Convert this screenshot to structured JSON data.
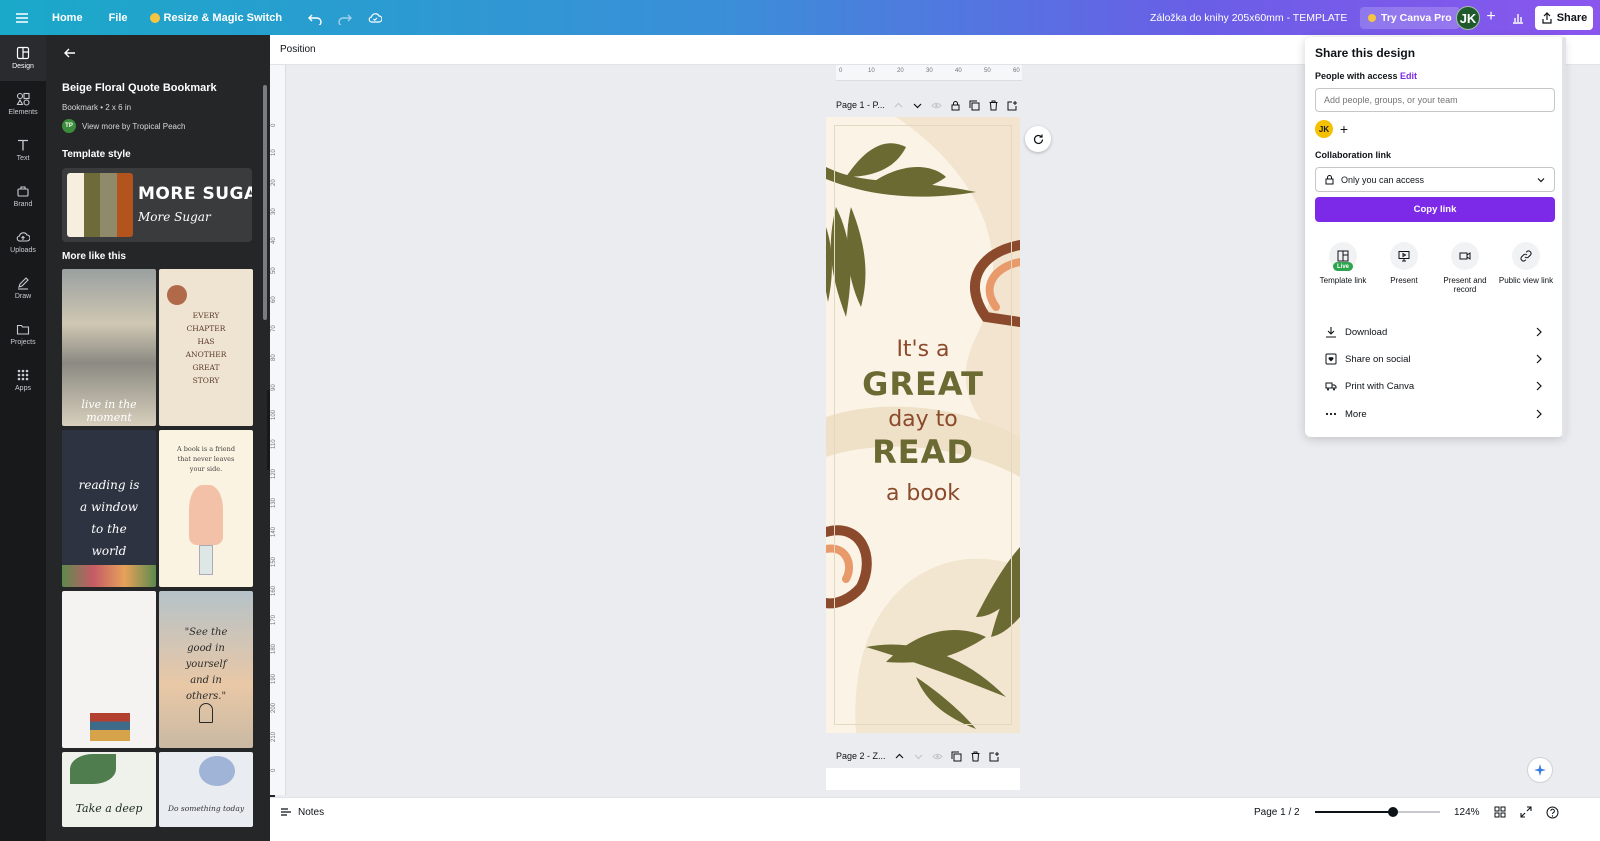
{
  "topbar": {
    "home": "Home",
    "file": "File",
    "resize": "Resize & Magic Switch",
    "doc_title": "Záložka do knihy 205x60mm - TEMPLATE",
    "try_pro": "Try Canva Pro",
    "avatar": "JK",
    "share": "Share"
  },
  "rail": {
    "items": [
      {
        "label": "Design",
        "icon": "layout-icon"
      },
      {
        "label": "Elements",
        "icon": "shapes-icon"
      },
      {
        "label": "Text",
        "icon": "text-icon"
      },
      {
        "label": "Brand",
        "icon": "brand-icon"
      },
      {
        "label": "Uploads",
        "icon": "cloud-upload-icon"
      },
      {
        "label": "Draw",
        "icon": "pen-icon"
      },
      {
        "label": "Projects",
        "icon": "folder-icon"
      },
      {
        "label": "Apps",
        "icon": "apps-grid-icon"
      }
    ]
  },
  "panel": {
    "title": "Beige Floral Quote Bookmark",
    "subtitle": "Bookmark • 2 x 6 in",
    "author_initials": "TP",
    "author_link": "View more by Tropical Peach",
    "template_style": "Template style",
    "style_big": "MORE SUGAR",
    "style_small": "More Sugar",
    "swatches": [
      "#f6efdf",
      "#6f6a3a",
      "#8f8b6a",
      "#b3541e"
    ],
    "more_like_this": "More like this",
    "thumbs": [
      {
        "text": "live in the moment"
      },
      {
        "text": "EVERY CHAPTER HAS ANOTHER GREAT STORY"
      },
      {
        "text": "reading is a window to the world"
      },
      {
        "text": "A book is a friend that never leaves your side."
      },
      {
        "text": ""
      },
      {
        "text": "\"See the good in yourself and in others.\""
      },
      {
        "text": "Take a deep"
      },
      {
        "text": "Do something today"
      }
    ]
  },
  "canvas": {
    "position_label": "Position",
    "page1_label": "Page 1 - P...",
    "page2_label": "Page 2 - Z...",
    "hruler_ticks": [
      "0",
      "10",
      "20",
      "30",
      "40",
      "50",
      "60"
    ],
    "vruler_ticks": [
      "0",
      "10",
      "20",
      "30",
      "40",
      "50",
      "60",
      "70",
      "80",
      "90",
      "100",
      "110",
      "120",
      "130",
      "140",
      "150",
      "160",
      "170",
      "180",
      "190",
      "200",
      "210",
      "0"
    ],
    "bookmark": {
      "line1": "It's a",
      "line2": "GREAT",
      "line3": "day to",
      "line4": "READ",
      "line5": "a book"
    }
  },
  "footer": {
    "notes": "Notes",
    "page": "Page 1 / 2",
    "zoom": "124%",
    "zoom_level": 0.62
  },
  "share_panel": {
    "title": "Share this design",
    "people_access": "People with access",
    "edit": "Edit",
    "add_placeholder": "Add people, groups, or your team",
    "member_initials": "JK",
    "collab_link": "Collaboration link",
    "access_value": "Only you can access",
    "copy_link": "Copy link",
    "options": [
      {
        "label": "Template link",
        "badge": "Live"
      },
      {
        "label": "Present"
      },
      {
        "label": "Present and record"
      },
      {
        "label": "Public view link"
      }
    ],
    "rows": [
      "Download",
      "Share on social",
      "Print with Canva",
      "More"
    ]
  }
}
